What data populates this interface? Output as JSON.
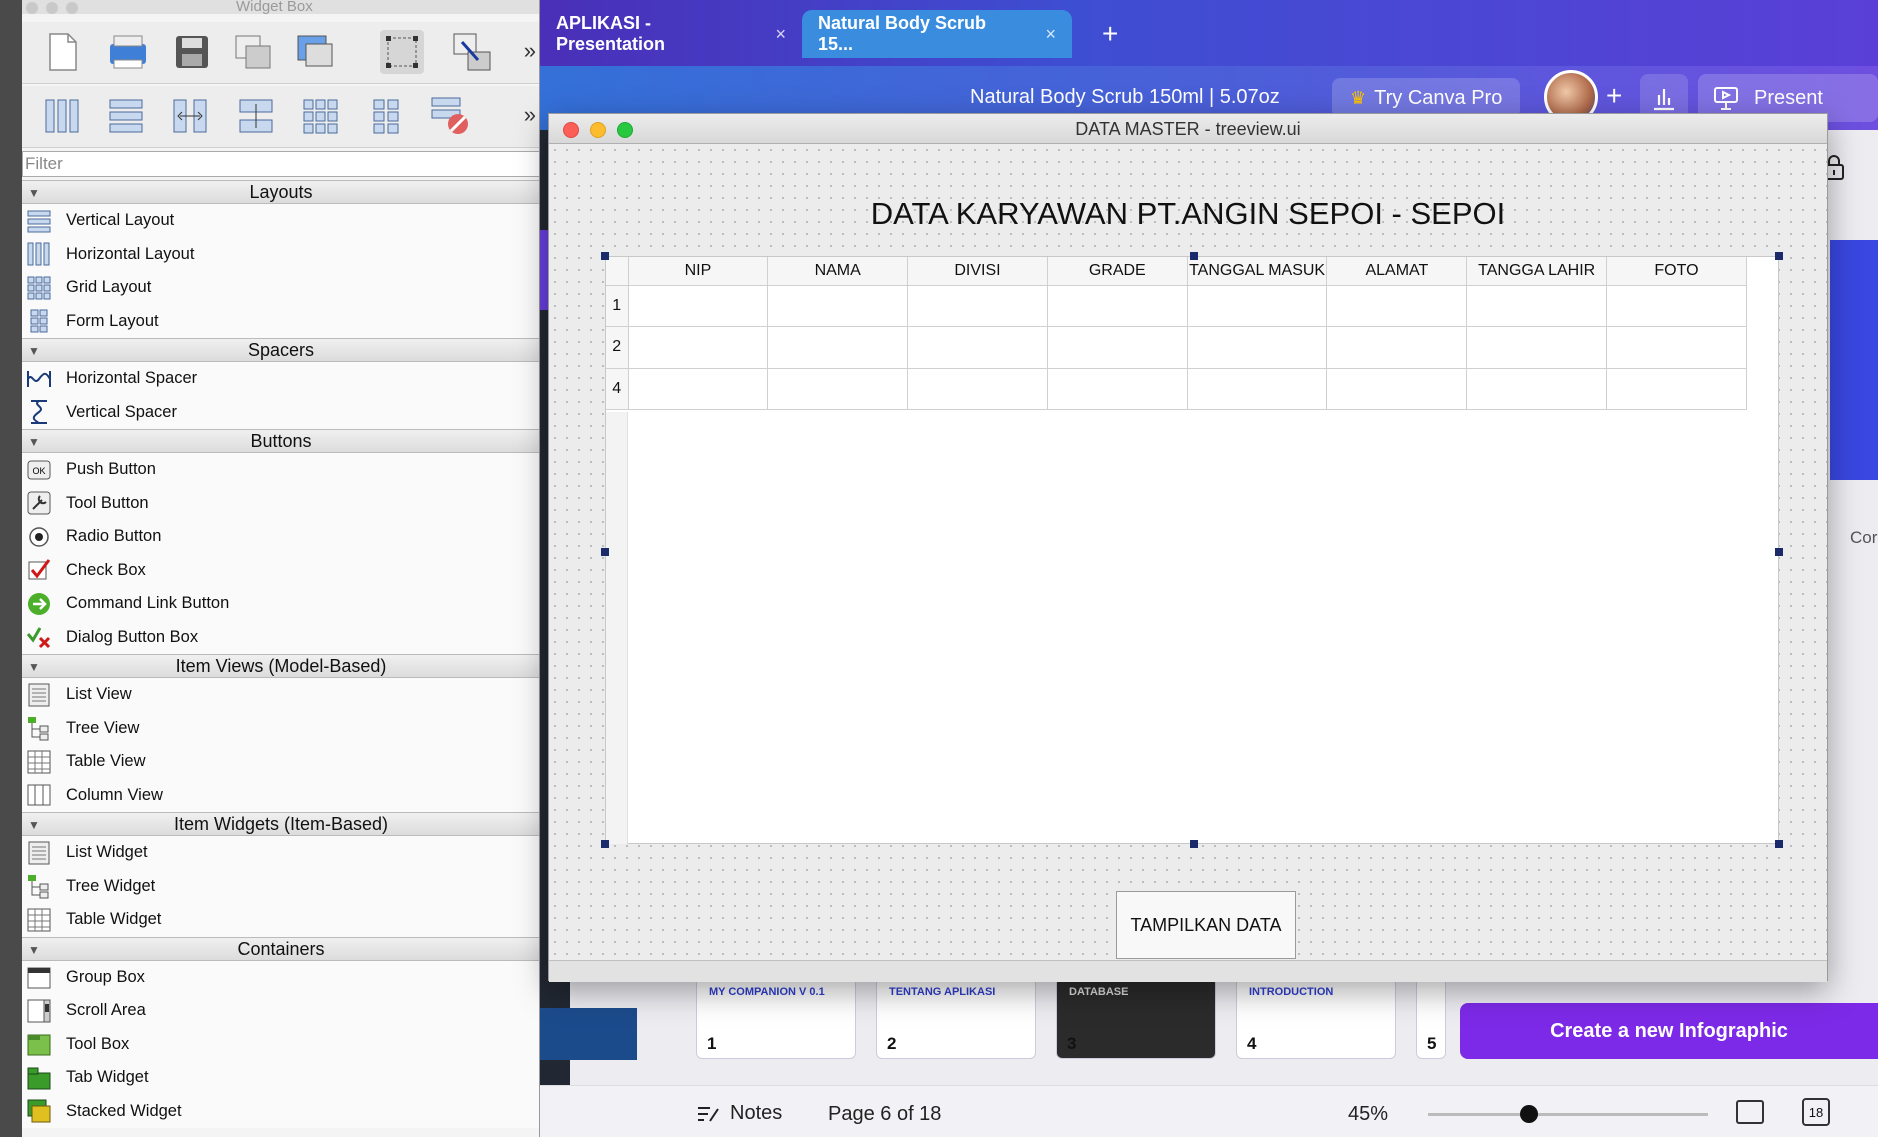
{
  "canva": {
    "tabs": [
      {
        "label": "APLIKASI - Presentation",
        "close": "×"
      },
      {
        "label": "Natural Body Scrub 15...",
        "close": "×"
      }
    ],
    "new_tab": "+",
    "doc_title": "Natural Body Scrub 150ml | 5.07oz",
    "try_pro": "Try Canva Pro",
    "add_collaborator": "+",
    "present": "Present",
    "side_text": "Cor",
    "thumbnails": [
      {
        "num": "1",
        "text": "MY COMPANION V 0.1"
      },
      {
        "num": "2",
        "text": "TENTANG APLIKASI"
      },
      {
        "num": "3",
        "text": "DATABASE"
      },
      {
        "num": "4",
        "text": "INTRODUCTION"
      },
      {
        "num": "5",
        "text": ""
      }
    ],
    "create_infographic": "Create a new Infographic",
    "notes": "Notes",
    "page_info": "Page 6 of 18",
    "zoom": "45%",
    "zoom_level": 0.45,
    "page_count": "18",
    "accent": "#7d2ae8"
  },
  "widget_box": {
    "title": "Widget Box",
    "filter_placeholder": "Filter",
    "more": "»",
    "categories": [
      {
        "label": "Layouts",
        "items": [
          "Vertical Layout",
          "Horizontal Layout",
          "Grid Layout",
          "Form Layout"
        ]
      },
      {
        "label": "Spacers",
        "items": [
          "Horizontal Spacer",
          "Vertical Spacer"
        ]
      },
      {
        "label": "Buttons",
        "items": [
          "Push Button",
          "Tool Button",
          "Radio Button",
          "Check Box",
          "Command Link Button",
          "Dialog Button Box"
        ]
      },
      {
        "label": "Item Views (Model-Based)",
        "items": [
          "List View",
          "Tree View",
          "Table View",
          "Column View"
        ]
      },
      {
        "label": "Item Widgets (Item-Based)",
        "items": [
          "List Widget",
          "Tree Widget",
          "Table Widget"
        ]
      },
      {
        "label": "Containers",
        "items": [
          "Group Box",
          "Scroll Area",
          "Tool Box",
          "Tab Widget",
          "Stacked Widget"
        ]
      }
    ],
    "push_button_icon_text": "OK"
  },
  "data_master": {
    "title": "DATA MASTER - treeview.ui",
    "heading": "DATA KARYAWAN PT.ANGIN SEPOI - SEPOI",
    "columns": [
      "NIP",
      "NAMA",
      "DIVISI",
      "GRADE",
      "TANGGAL MASUK",
      "ALAMAT",
      "TANGGA LAHIR",
      "FOTO"
    ],
    "rows": [
      "1",
      "2",
      "4"
    ],
    "button": "TAMPILKAN DATA"
  }
}
